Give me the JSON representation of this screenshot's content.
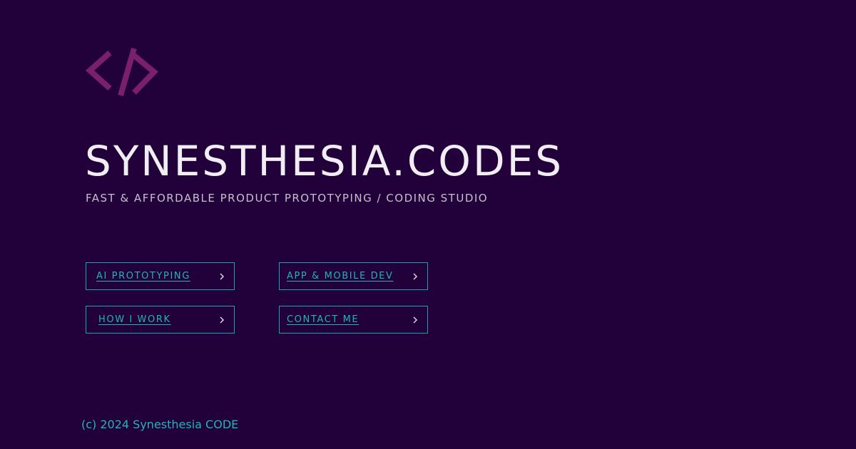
{
  "logo": {
    "icon": "code-brackets-icon",
    "color": "#7a1f6b"
  },
  "hero": {
    "title": "SYNESTHESIA.CODES",
    "tagline": "FAST & AFFORDABLE PRODUCT PROTOTYPING / CODING STUDIO"
  },
  "nav": {
    "buttons": [
      {
        "label": "AI PROTOTYPING",
        "icon": "chevron-right-icon"
      },
      {
        "label": "APP & MOBILE DEV",
        "icon": "chevron-right-icon"
      },
      {
        "label": "HOW I WORK",
        "icon": "chevron-right-icon"
      },
      {
        "label": "CONTACT ME",
        "icon": "chevron-right-icon"
      }
    ]
  },
  "footer": {
    "copyright": "(c) 2024 Synesthesia CODE"
  },
  "colors": {
    "background": "#22003a",
    "accent": "#1fb6b3",
    "title": "#f1eef3",
    "logo": "#7a1f6b"
  }
}
